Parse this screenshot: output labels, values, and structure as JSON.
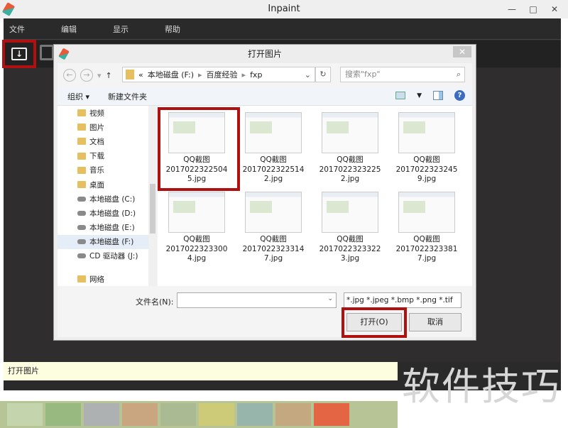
{
  "app": {
    "title": "Inpaint",
    "window_controls": [
      "—",
      "□",
      "✕"
    ]
  },
  "menu": [
    "文件",
    "编辑",
    "显示",
    "帮助"
  ],
  "toolbar": {
    "open_icon": "open-image-icon",
    "save_icon": "save-icon"
  },
  "dialog": {
    "title": "打开图片",
    "close": "✕",
    "nav": {
      "back": "←",
      "forward": "→",
      "dropdown": "▾",
      "up": "↑"
    },
    "address": {
      "prefix": "«",
      "parts": [
        "本地磁盘 (F:)",
        "百度经验",
        "fxp"
      ],
      "sep": "▸",
      "dropdown": "⌄",
      "refresh": "↻"
    },
    "search": {
      "placeholder": "搜索\"fxp\"",
      "icon": "⌕"
    },
    "cmd": {
      "organize": "组织 ▾",
      "new_folder": "新建文件夹",
      "help": "?"
    },
    "nav_pane": [
      "视频",
      "图片",
      "文档",
      "下载",
      "音乐",
      "桌面",
      "本地磁盘 (C:)",
      "本地磁盘 (D:)",
      "本地磁盘 (E:)",
      "本地磁盘 (F:)",
      "CD 驱动器 (J:)",
      "网络"
    ],
    "files": [
      [
        "QQ截图",
        "2017022322504",
        "5.jpg"
      ],
      [
        "QQ截图",
        "2017022322514",
        "2.jpg"
      ],
      [
        "QQ截图",
        "2017022323225",
        "2.jpg"
      ],
      [
        "QQ截图",
        "2017022323245",
        "9.jpg"
      ],
      [
        "QQ截图",
        "2017022323300",
        "4.jpg"
      ],
      [
        "QQ截图",
        "2017022323314",
        "7.jpg"
      ],
      [
        "QQ截图",
        "2017022323322",
        "3.jpg"
      ],
      [
        "QQ截图",
        "2017022323381",
        "7.jpg"
      ]
    ],
    "filename_label": "文件名(N):",
    "filename_value": "",
    "filename_dropdown": "⌄",
    "filetype": "*.jpg *.jpeg *.bmp *.png *.tif ⌄",
    "open": "打开(O)",
    "cancel": "取消"
  },
  "status": "打开图片",
  "watermark": "软件技巧"
}
